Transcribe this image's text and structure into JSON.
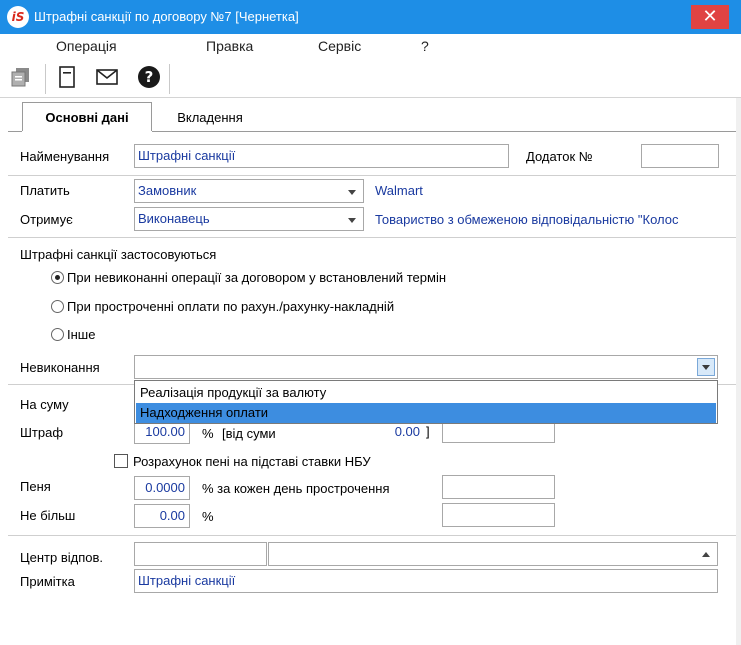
{
  "window": {
    "title": "Штрафні санкції по договору №7 [Чернетка]",
    "logo_text": "iS",
    "close_symbol": "✕"
  },
  "menu": [
    "Операція",
    "Правка",
    "Сервіс",
    "?"
  ],
  "toolbar": {
    "icons": [
      "copy-document-icon",
      "document-icon",
      "envelope-icon",
      "help-icon"
    ],
    "help_glyph": "?"
  },
  "tabs": [
    {
      "label": "Основні дані",
      "active": true
    },
    {
      "label": "Вкладення",
      "active": false
    }
  ],
  "form": {
    "name_label": "Найменування",
    "name_value": "Штрафні санкції",
    "addendum_label": "Додаток №",
    "addendum_value": "",
    "payer_label": "Платить",
    "payer_value": "Замовник",
    "payer_party": "Walmart",
    "receiver_label": "Отримує",
    "receiver_value": "Виконавець",
    "receiver_party": "Товариство з обмеженою відповідальністю \"Колос",
    "applied_label": "Штрафні санкції застосовуються",
    "radio_options": [
      {
        "label": "При невиконанні операції за договором у встановлений термін",
        "checked": true
      },
      {
        "label": "При простроченні оплати по рахун./рахунку-накладній",
        "checked": false
      },
      {
        "label": "Інше",
        "checked": false
      }
    ],
    "failure_label": "Невиконання",
    "failure_value": "",
    "failure_options": [
      {
        "label": "Реалізація продукції за валюту",
        "selected": false
      },
      {
        "label": "Надходження оплати",
        "selected": true
      }
    ],
    "amount_label": "На суму",
    "fine_label": "Штраф",
    "fine_value": "100.00",
    "fine_pct": "%",
    "fine_of_sum": "[від суми",
    "fine_base_value": "0.00",
    "fine_bracket": "]",
    "fine_extra_value": "",
    "nbu_checkbox_label": "Розрахунок пені на підставі ставки НБУ",
    "nbu_checked": false,
    "penalty_label": "Пеня",
    "penalty_value": "0.0000",
    "penalty_suffix": "% за кожен день прострочення",
    "penalty_extra_value": "",
    "max_label": "Не більш",
    "max_value": "0.00",
    "max_pct": "%",
    "max_extra_value": "",
    "center_label": "Центр відпов.",
    "center_code": "",
    "center_name": "",
    "note_label": "Примітка",
    "note_value": "Штрафні санкції"
  }
}
